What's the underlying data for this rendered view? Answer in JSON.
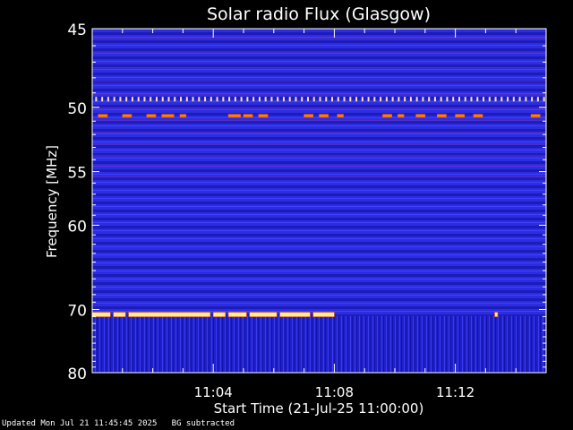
{
  "chart_data": {
    "type": "heatmap",
    "title": "Solar radio Flux (Glasgow)",
    "xlabel": "Start Time (21-Jul-25 11:00:00)",
    "ylabel": "Frequency [MHz]",
    "x_unit": "minutes after 11:00:00",
    "xlim": [
      0,
      15
    ],
    "ylim": [
      45,
      80
    ],
    "y_scale": "reciprocal",
    "x_ticks": [
      {
        "value": 4,
        "label": "11:04"
      },
      {
        "value": 8,
        "label": "11:08"
      },
      {
        "value": 12,
        "label": "11:12"
      }
    ],
    "y_ticks": [
      {
        "value": 45,
        "label": "45"
      },
      {
        "value": 50,
        "label": "50"
      },
      {
        "value": 55,
        "label": "55"
      },
      {
        "value": 60,
        "label": "60"
      },
      {
        "value": 70,
        "label": "70"
      },
      {
        "value": 80,
        "label": "80"
      }
    ],
    "colormap": [
      "#000080",
      "#1a1ad0",
      "#3030ff",
      "#8020a0",
      "#d01010",
      "#ff8000",
      "#ffff80",
      "#ffffff"
    ],
    "background_color": "#2828d8",
    "features": [
      {
        "name": "interference line",
        "freq_mhz": 49.4,
        "t_start": 0,
        "t_end": 15,
        "style": "dashed",
        "color": "#ffe0b0"
      },
      {
        "name": "interference bursts",
        "freq_mhz": 50.6,
        "segments": [
          [
            0.2,
            0.5
          ],
          [
            1.0,
            1.3
          ],
          [
            1.8,
            2.1
          ],
          [
            2.3,
            2.7
          ],
          [
            2.9,
            3.1
          ],
          [
            4.5,
            4.9
          ],
          [
            5.0,
            5.3
          ],
          [
            5.5,
            5.8
          ],
          [
            7.0,
            7.3
          ],
          [
            7.5,
            7.8
          ],
          [
            8.1,
            8.3
          ],
          [
            9.6,
            9.9
          ],
          [
            10.1,
            10.3
          ],
          [
            10.7,
            11.0
          ],
          [
            11.4,
            11.7
          ],
          [
            12.0,
            12.3
          ],
          [
            12.6,
            12.9
          ],
          [
            14.5,
            14.8
          ]
        ],
        "color": "#ff8000"
      },
      {
        "name": "interference line",
        "freq_mhz": 70.7,
        "segments": [
          [
            0,
            0.6
          ],
          [
            0.7,
            1.1
          ],
          [
            1.2,
            3.9
          ],
          [
            4.0,
            4.4
          ],
          [
            4.5,
            5.1
          ],
          [
            5.2,
            6.1
          ],
          [
            6.2,
            7.2
          ],
          [
            7.3,
            8.0
          ],
          [
            13.3,
            13.4
          ]
        ],
        "color": "#fff0a0"
      }
    ],
    "grid": false,
    "legend": "none"
  },
  "footer": {
    "updated": "Updated Mon Jul 21 11:45:45 2025",
    "note": "BG subtracted"
  }
}
